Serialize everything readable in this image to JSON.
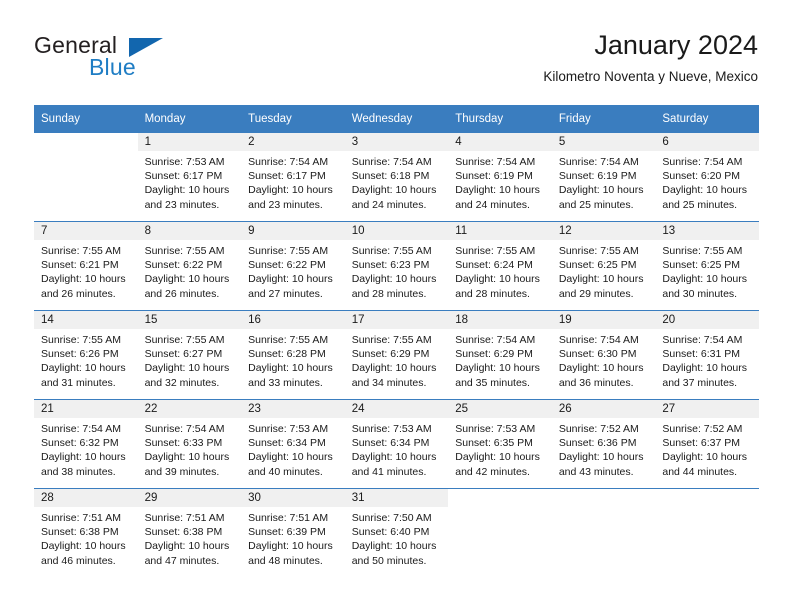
{
  "brand": {
    "name_part1": "General",
    "name_part2": "Blue",
    "flag_icon": "triangle-flag-icon",
    "accent_color": "#1266ae",
    "blue_text_color": "#1f7dc4"
  },
  "header": {
    "title": "January 2024",
    "subtitle": "Kilometro Noventa y Nueve, Mexico"
  },
  "calendar": {
    "header_background": "#3a7dbf",
    "daynum_band_background": "#f0f0f0",
    "weekdays": [
      "Sunday",
      "Monday",
      "Tuesday",
      "Wednesday",
      "Thursday",
      "Friday",
      "Saturday"
    ],
    "weeks": [
      [
        {
          "day": "",
          "sunrise": "",
          "sunset": "",
          "daylight1": "",
          "daylight2": ""
        },
        {
          "day": "1",
          "sunrise": "Sunrise: 7:53 AM",
          "sunset": "Sunset: 6:17 PM",
          "daylight1": "Daylight: 10 hours",
          "daylight2": "and 23 minutes."
        },
        {
          "day": "2",
          "sunrise": "Sunrise: 7:54 AM",
          "sunset": "Sunset: 6:17 PM",
          "daylight1": "Daylight: 10 hours",
          "daylight2": "and 23 minutes."
        },
        {
          "day": "3",
          "sunrise": "Sunrise: 7:54 AM",
          "sunset": "Sunset: 6:18 PM",
          "daylight1": "Daylight: 10 hours",
          "daylight2": "and 24 minutes."
        },
        {
          "day": "4",
          "sunrise": "Sunrise: 7:54 AM",
          "sunset": "Sunset: 6:19 PM",
          "daylight1": "Daylight: 10 hours",
          "daylight2": "and 24 minutes."
        },
        {
          "day": "5",
          "sunrise": "Sunrise: 7:54 AM",
          "sunset": "Sunset: 6:19 PM",
          "daylight1": "Daylight: 10 hours",
          "daylight2": "and 25 minutes."
        },
        {
          "day": "6",
          "sunrise": "Sunrise: 7:54 AM",
          "sunset": "Sunset: 6:20 PM",
          "daylight1": "Daylight: 10 hours",
          "daylight2": "and 25 minutes."
        }
      ],
      [
        {
          "day": "7",
          "sunrise": "Sunrise: 7:55 AM",
          "sunset": "Sunset: 6:21 PM",
          "daylight1": "Daylight: 10 hours",
          "daylight2": "and 26 minutes."
        },
        {
          "day": "8",
          "sunrise": "Sunrise: 7:55 AM",
          "sunset": "Sunset: 6:22 PM",
          "daylight1": "Daylight: 10 hours",
          "daylight2": "and 26 minutes."
        },
        {
          "day": "9",
          "sunrise": "Sunrise: 7:55 AM",
          "sunset": "Sunset: 6:22 PM",
          "daylight1": "Daylight: 10 hours",
          "daylight2": "and 27 minutes."
        },
        {
          "day": "10",
          "sunrise": "Sunrise: 7:55 AM",
          "sunset": "Sunset: 6:23 PM",
          "daylight1": "Daylight: 10 hours",
          "daylight2": "and 28 minutes."
        },
        {
          "day": "11",
          "sunrise": "Sunrise: 7:55 AM",
          "sunset": "Sunset: 6:24 PM",
          "daylight1": "Daylight: 10 hours",
          "daylight2": "and 28 minutes."
        },
        {
          "day": "12",
          "sunrise": "Sunrise: 7:55 AM",
          "sunset": "Sunset: 6:25 PM",
          "daylight1": "Daylight: 10 hours",
          "daylight2": "and 29 minutes."
        },
        {
          "day": "13",
          "sunrise": "Sunrise: 7:55 AM",
          "sunset": "Sunset: 6:25 PM",
          "daylight1": "Daylight: 10 hours",
          "daylight2": "and 30 minutes."
        }
      ],
      [
        {
          "day": "14",
          "sunrise": "Sunrise: 7:55 AM",
          "sunset": "Sunset: 6:26 PM",
          "daylight1": "Daylight: 10 hours",
          "daylight2": "and 31 minutes."
        },
        {
          "day": "15",
          "sunrise": "Sunrise: 7:55 AM",
          "sunset": "Sunset: 6:27 PM",
          "daylight1": "Daylight: 10 hours",
          "daylight2": "and 32 minutes."
        },
        {
          "day": "16",
          "sunrise": "Sunrise: 7:55 AM",
          "sunset": "Sunset: 6:28 PM",
          "daylight1": "Daylight: 10 hours",
          "daylight2": "and 33 minutes."
        },
        {
          "day": "17",
          "sunrise": "Sunrise: 7:55 AM",
          "sunset": "Sunset: 6:29 PM",
          "daylight1": "Daylight: 10 hours",
          "daylight2": "and 34 minutes."
        },
        {
          "day": "18",
          "sunrise": "Sunrise: 7:54 AM",
          "sunset": "Sunset: 6:29 PM",
          "daylight1": "Daylight: 10 hours",
          "daylight2": "and 35 minutes."
        },
        {
          "day": "19",
          "sunrise": "Sunrise: 7:54 AM",
          "sunset": "Sunset: 6:30 PM",
          "daylight1": "Daylight: 10 hours",
          "daylight2": "and 36 minutes."
        },
        {
          "day": "20",
          "sunrise": "Sunrise: 7:54 AM",
          "sunset": "Sunset: 6:31 PM",
          "daylight1": "Daylight: 10 hours",
          "daylight2": "and 37 minutes."
        }
      ],
      [
        {
          "day": "21",
          "sunrise": "Sunrise: 7:54 AM",
          "sunset": "Sunset: 6:32 PM",
          "daylight1": "Daylight: 10 hours",
          "daylight2": "and 38 minutes."
        },
        {
          "day": "22",
          "sunrise": "Sunrise: 7:54 AM",
          "sunset": "Sunset: 6:33 PM",
          "daylight1": "Daylight: 10 hours",
          "daylight2": "and 39 minutes."
        },
        {
          "day": "23",
          "sunrise": "Sunrise: 7:53 AM",
          "sunset": "Sunset: 6:34 PM",
          "daylight1": "Daylight: 10 hours",
          "daylight2": "and 40 minutes."
        },
        {
          "day": "24",
          "sunrise": "Sunrise: 7:53 AM",
          "sunset": "Sunset: 6:34 PM",
          "daylight1": "Daylight: 10 hours",
          "daylight2": "and 41 minutes."
        },
        {
          "day": "25",
          "sunrise": "Sunrise: 7:53 AM",
          "sunset": "Sunset: 6:35 PM",
          "daylight1": "Daylight: 10 hours",
          "daylight2": "and 42 minutes."
        },
        {
          "day": "26",
          "sunrise": "Sunrise: 7:52 AM",
          "sunset": "Sunset: 6:36 PM",
          "daylight1": "Daylight: 10 hours",
          "daylight2": "and 43 minutes."
        },
        {
          "day": "27",
          "sunrise": "Sunrise: 7:52 AM",
          "sunset": "Sunset: 6:37 PM",
          "daylight1": "Daylight: 10 hours",
          "daylight2": "and 44 minutes."
        }
      ],
      [
        {
          "day": "28",
          "sunrise": "Sunrise: 7:51 AM",
          "sunset": "Sunset: 6:38 PM",
          "daylight1": "Daylight: 10 hours",
          "daylight2": "and 46 minutes."
        },
        {
          "day": "29",
          "sunrise": "Sunrise: 7:51 AM",
          "sunset": "Sunset: 6:38 PM",
          "daylight1": "Daylight: 10 hours",
          "daylight2": "and 47 minutes."
        },
        {
          "day": "30",
          "sunrise": "Sunrise: 7:51 AM",
          "sunset": "Sunset: 6:39 PM",
          "daylight1": "Daylight: 10 hours",
          "daylight2": "and 48 minutes."
        },
        {
          "day": "31",
          "sunrise": "Sunrise: 7:50 AM",
          "sunset": "Sunset: 6:40 PM",
          "daylight1": "Daylight: 10 hours",
          "daylight2": "and 50 minutes."
        },
        {
          "day": "",
          "sunrise": "",
          "sunset": "",
          "daylight1": "",
          "daylight2": ""
        },
        {
          "day": "",
          "sunrise": "",
          "sunset": "",
          "daylight1": "",
          "daylight2": ""
        },
        {
          "day": "",
          "sunrise": "",
          "sunset": "",
          "daylight1": "",
          "daylight2": ""
        }
      ]
    ]
  }
}
